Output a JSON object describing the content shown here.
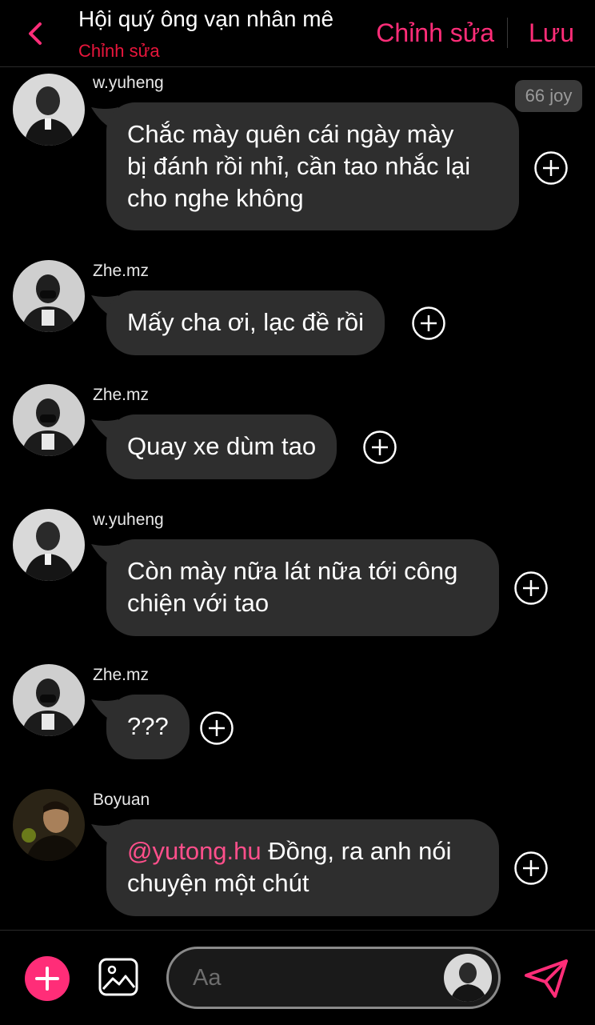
{
  "header": {
    "title": "Hội quý ông vạn nhân mê",
    "subtitle": "Chỉnh sửa",
    "edit_label": "Chỉnh sửa",
    "save_label": "Lưu"
  },
  "colors": {
    "accent": "#ff2d78",
    "subtitle_red": "#e8163c",
    "bubble": "#2e2e2e",
    "background": "#000000"
  },
  "messages": [
    {
      "sender": "w.yuheng",
      "lines": [
        "Chắc mày quên cái ngày mày",
        "bị đánh rồi nhỉ, cần tao nhắc lại",
        "cho nghe không"
      ],
      "badge": "66 joy"
    },
    {
      "sender": "Zhe.mz",
      "lines": [
        "Mấy cha ơi, lạc đề rồi"
      ]
    },
    {
      "sender": "Zhe.mz",
      "lines": [
        "Quay xe dùm tao"
      ]
    },
    {
      "sender": "w.yuheng",
      "lines": [
        "Còn mày nữa lát nữa tới công",
        "chiện với tao"
      ]
    },
    {
      "sender": "Zhe.mz",
      "lines": [
        "???"
      ]
    },
    {
      "sender": "Boyuan",
      "mention": "@yutong.hu",
      "lines": [
        " Đồng, ra anh nói",
        "chuyện một chút"
      ]
    }
  ],
  "composer": {
    "placeholder": "Aa",
    "icons": [
      "plus-icon",
      "image-icon",
      "send-icon"
    ]
  }
}
